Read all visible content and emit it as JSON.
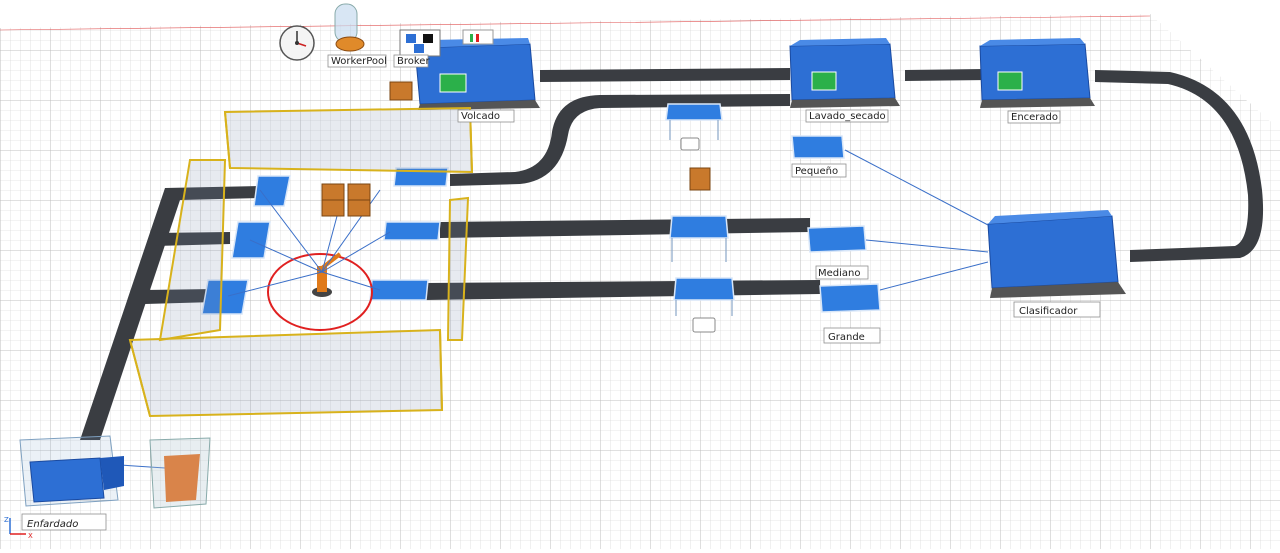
{
  "window": {
    "title": ""
  },
  "toolbar": {
    "clock_label": "",
    "workerpool_label": "WorkerPool",
    "broker_label": "Broker"
  },
  "stations": {
    "volcado": "Volcado",
    "lavado_secado": "Lavado_secado",
    "encerado": "Encerado",
    "clasificador": "Clasificador",
    "pequeno": "Pequeño",
    "mediano": "Mediano",
    "grande": "Grande",
    "enfardado": "Enfardado"
  },
  "axis": {
    "z": "Z",
    "x": "X"
  },
  "colors": {
    "machine": "#2d6fd4",
    "conveyor": "#3a3d42",
    "fence": "#d8b21c",
    "robot_zone": "#e02020",
    "box": "#c9792c",
    "grid_line": "#c8c8c8"
  }
}
